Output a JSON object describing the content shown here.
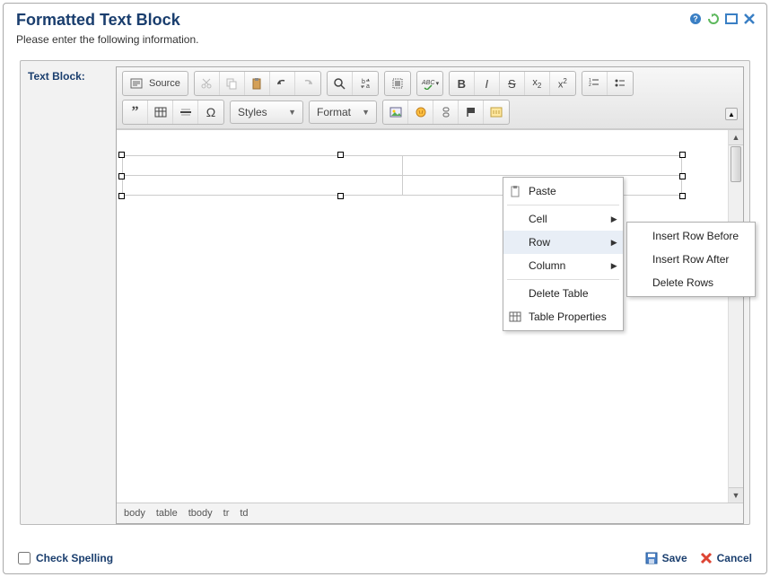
{
  "dialog": {
    "title": "Formatted Text Block",
    "subtitle": "Please enter the following information."
  },
  "label": "Text Block:",
  "toolbar": {
    "source": "Source",
    "styles": "Styles",
    "format": "Format"
  },
  "context_menu": {
    "paste": "Paste",
    "cell": "Cell",
    "row": "Row",
    "column": "Column",
    "delete_table": "Delete Table",
    "table_props": "Table Properties"
  },
  "sub_menu": {
    "insert_before": "Insert Row Before",
    "insert_after": "Insert Row After",
    "delete_rows": "Delete Rows"
  },
  "status_path": {
    "p0": "body",
    "p1": "table",
    "p2": "tbody",
    "p3": "tr",
    "p4": "td"
  },
  "footer": {
    "check_spelling": "Check Spelling",
    "save": "Save",
    "cancel": "Cancel"
  }
}
